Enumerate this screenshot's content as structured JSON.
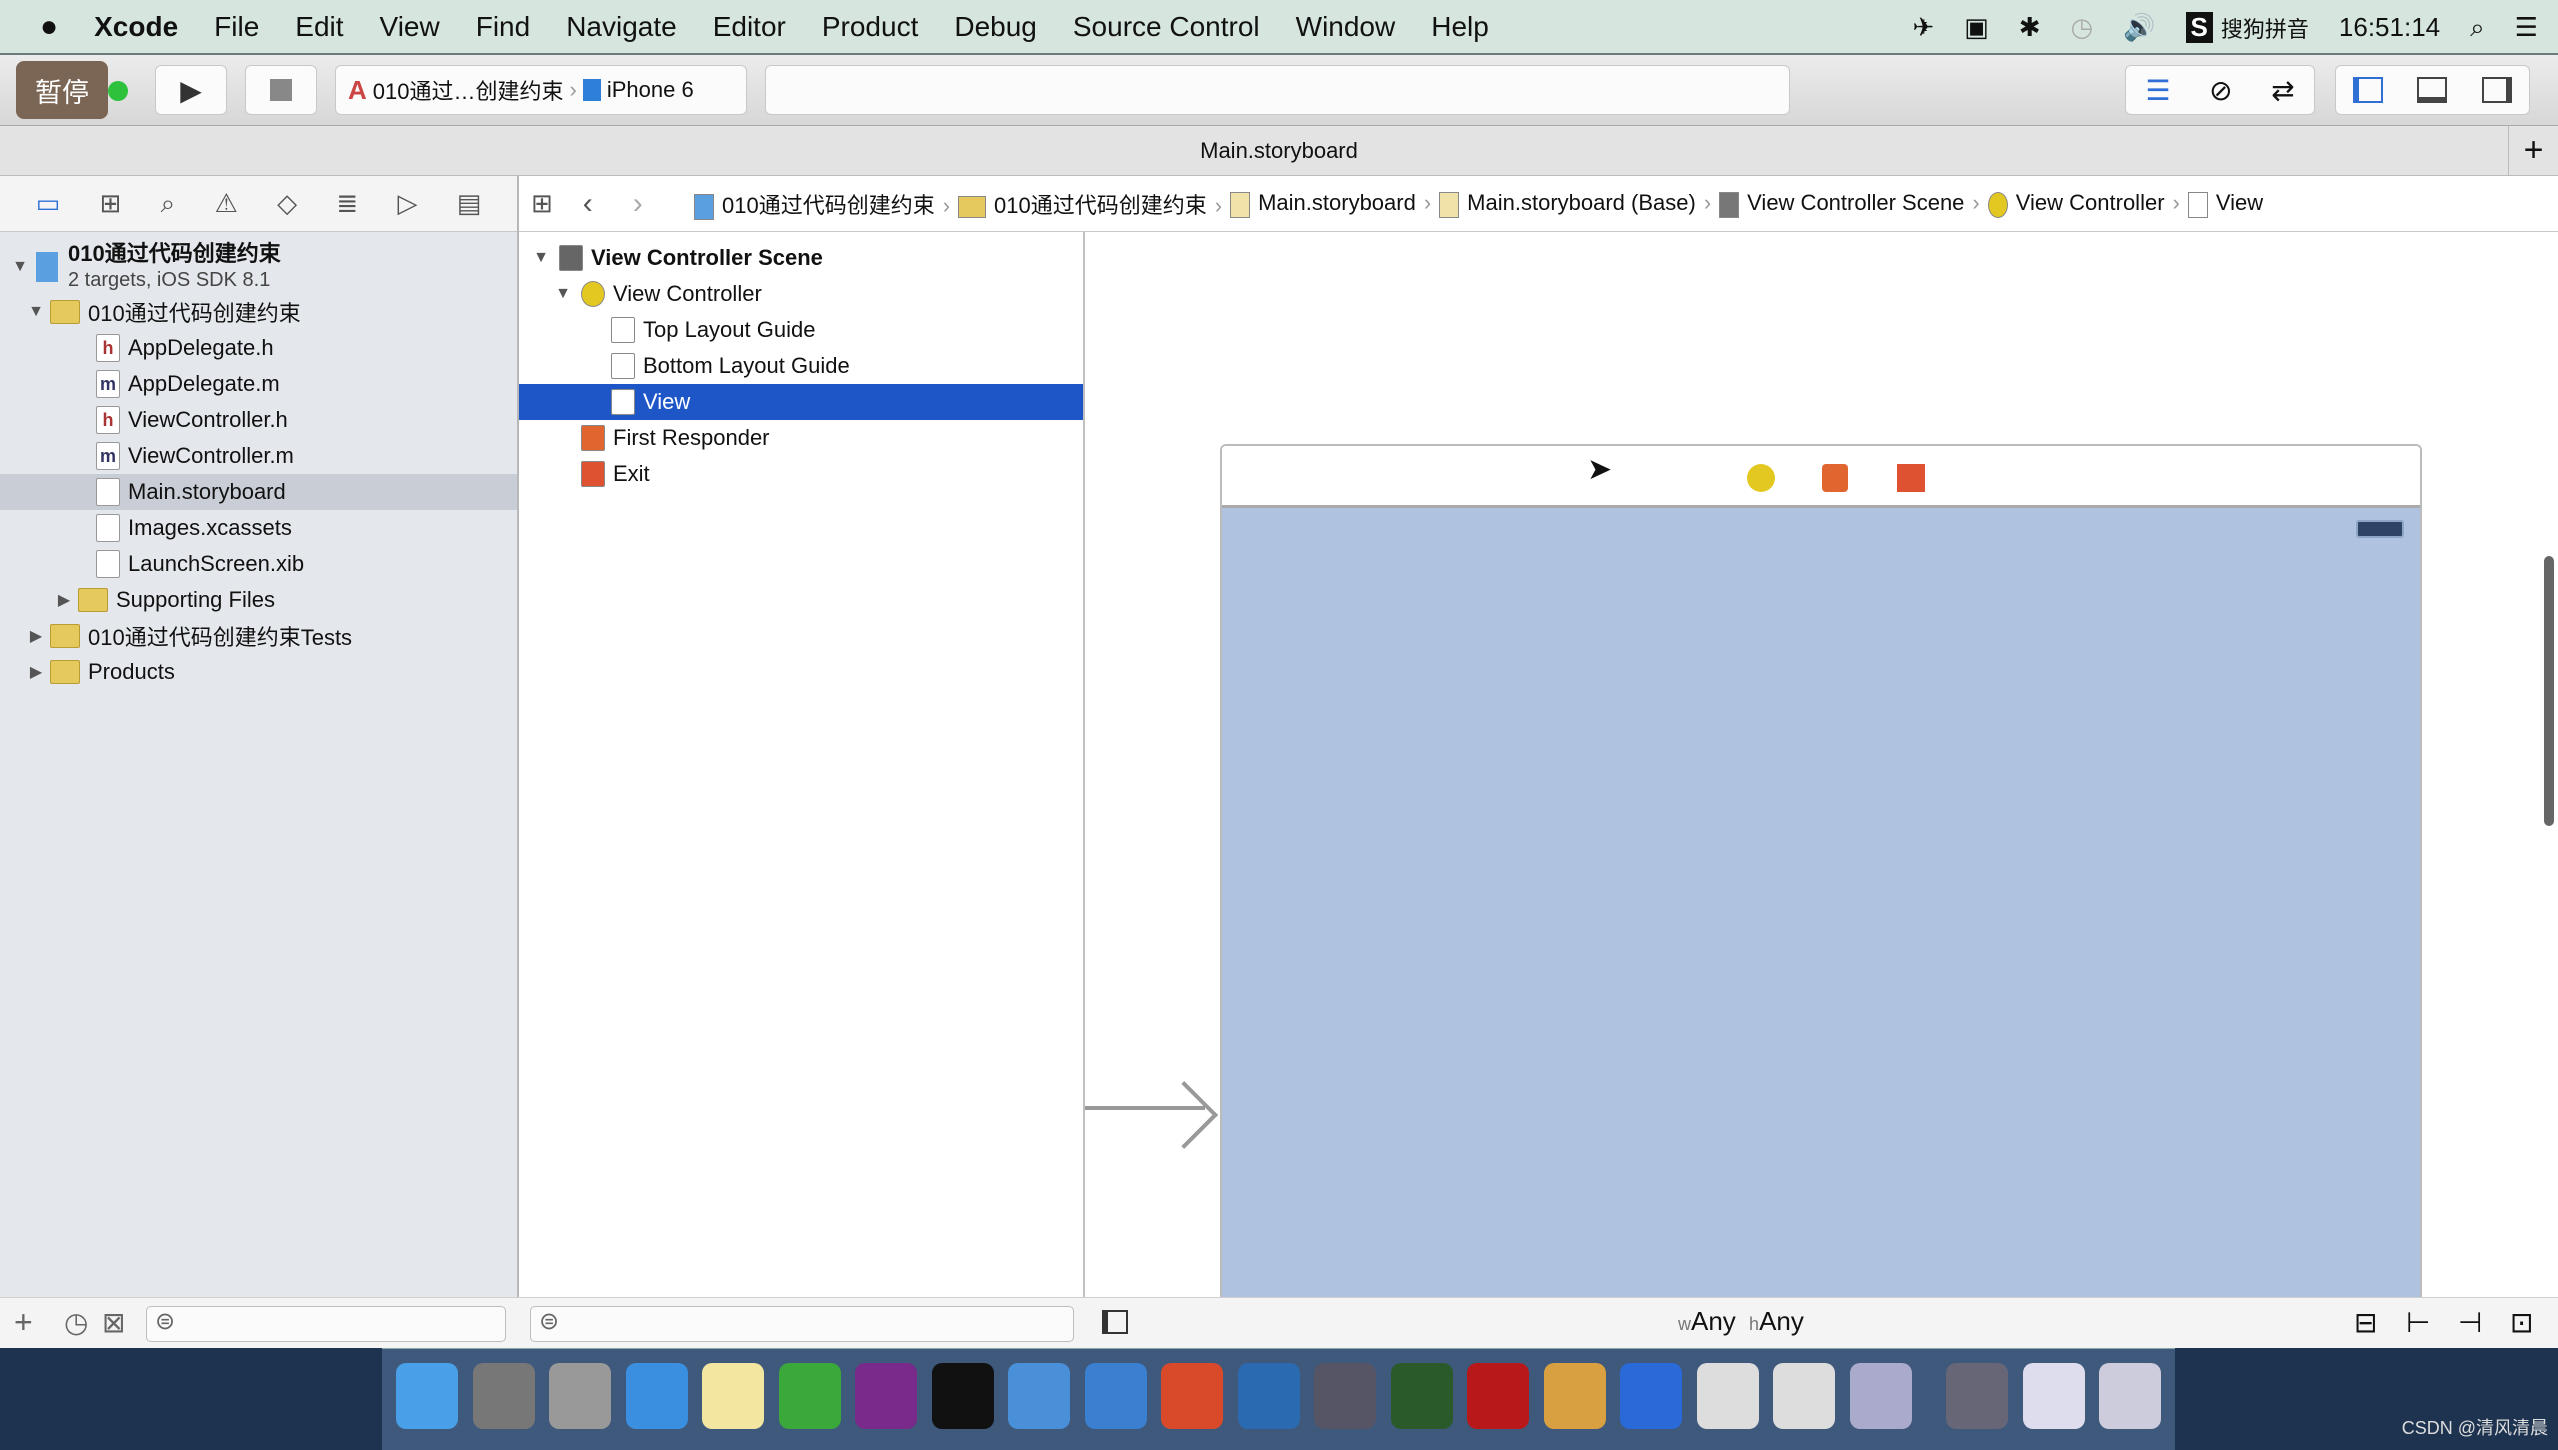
{
  "menubar": {
    "apple": "",
    "app": "Xcode",
    "items": [
      "File",
      "Edit",
      "View",
      "Find",
      "Navigate",
      "Editor",
      "Product",
      "Debug",
      "Source Control",
      "Window",
      "Help"
    ],
    "input_method": "搜狗拼音",
    "clock": "16:51:14"
  },
  "toolbar": {
    "pause_label": "暂停",
    "scheme": "010通过…创建约束",
    "device": "iPhone 6"
  },
  "tab": {
    "title": "Main.storyboard",
    "add": "+"
  },
  "breadcrumb": [
    "010通过代码创建约束",
    "010通过代码创建约束",
    "Main.storyboard",
    "Main.storyboard (Base)",
    "View Controller Scene",
    "View Controller",
    "View"
  ],
  "navigator": {
    "project": {
      "name": "010通过代码创建约束",
      "subtitle": "2 targets, iOS SDK 8.1"
    },
    "items": [
      {
        "label": "010通过代码创建约束",
        "type": "folder",
        "level": 1,
        "open": true
      },
      {
        "label": "AppDelegate.h",
        "type": "h",
        "level": 2
      },
      {
        "label": "AppDelegate.m",
        "type": "m",
        "level": 2
      },
      {
        "label": "ViewController.h",
        "type": "h",
        "level": 2
      },
      {
        "label": "ViewController.m",
        "type": "m",
        "level": 2
      },
      {
        "label": "Main.storyboard",
        "type": "storyboard",
        "level": 2,
        "selected": true
      },
      {
        "label": "Images.xcassets",
        "type": "assets",
        "level": 2
      },
      {
        "label": "LaunchScreen.xib",
        "type": "xib",
        "level": 2
      },
      {
        "label": "Supporting Files",
        "type": "folder",
        "level": 2,
        "open": false
      },
      {
        "label": "010通过代码创建约束Tests",
        "type": "folder",
        "level": 1,
        "open": false
      },
      {
        "label": "Products",
        "type": "folder",
        "level": 1,
        "open": false
      }
    ]
  },
  "outline": {
    "items": [
      {
        "label": "View Controller Scene",
        "level": 0,
        "bold": true
      },
      {
        "label": "View Controller",
        "level": 1
      },
      {
        "label": "Top Layout Guide",
        "level": 2
      },
      {
        "label": "Bottom Layout Guide",
        "level": 2
      },
      {
        "label": "View",
        "level": 2,
        "selected": true
      },
      {
        "label": "First Responder",
        "level": 1
      },
      {
        "label": "Exit",
        "level": 1
      }
    ]
  },
  "canvas": {
    "size_w_prefix": "w",
    "size_w": "Any",
    "size_h_prefix": "h",
    "size_h": "Any",
    "view_color": "#afc2e0"
  },
  "colors": {
    "selection": "#1e56c8",
    "accent": "#2f6fd6"
  },
  "watermark": "CSDN @清风清晨"
}
